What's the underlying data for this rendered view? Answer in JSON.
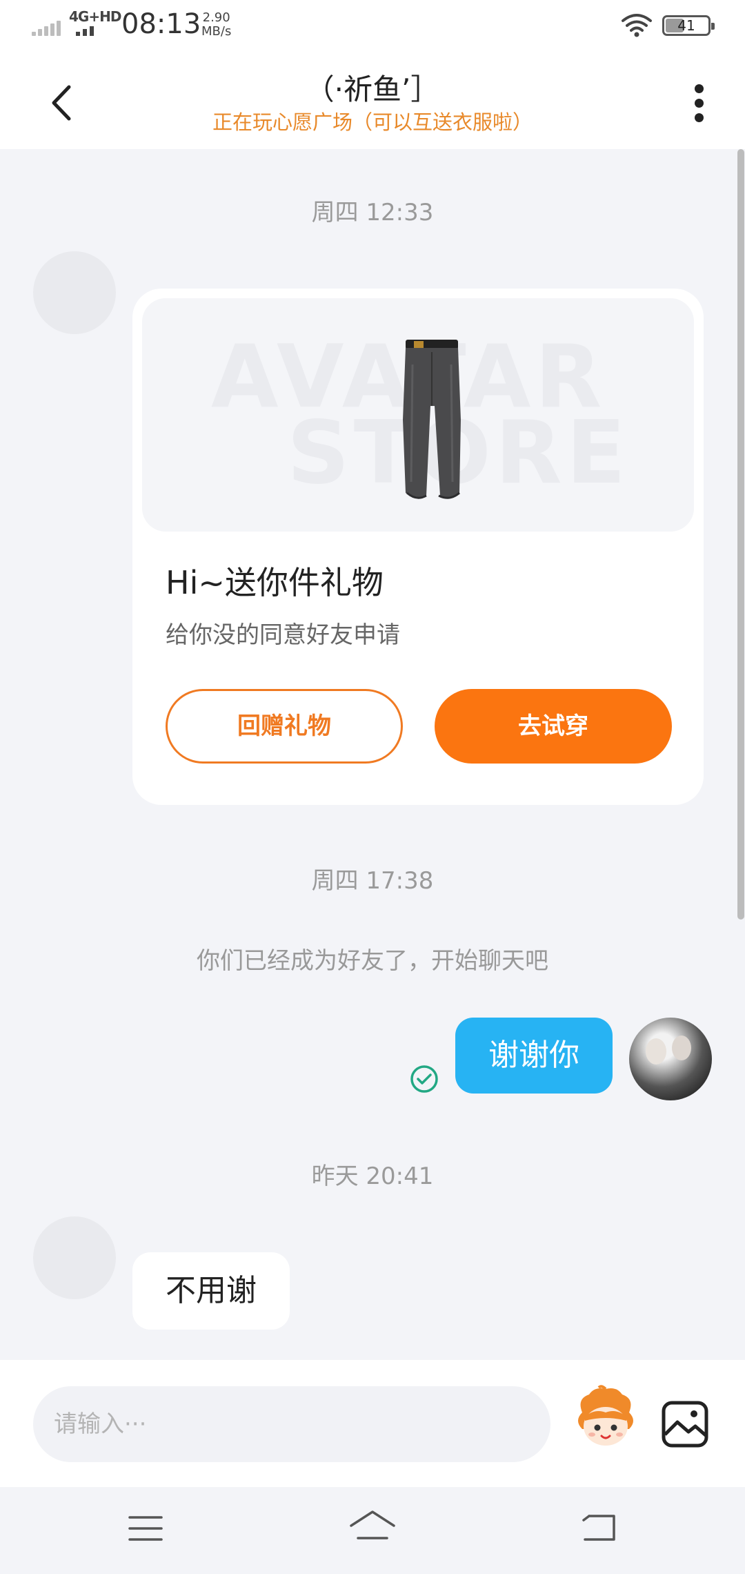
{
  "status_bar": {
    "network": "4G+HD",
    "time": "08:13",
    "speed_value": "2.90",
    "speed_unit": "MB/s",
    "battery": "41",
    "battery_level": 0.41
  },
  "header": {
    "title": "（·祈鱼’］",
    "subtitle": "正在玩心愿广场（可以互送衣服啦）"
  },
  "chat": {
    "timestamp_1": "周四 12:33",
    "gift_card": {
      "watermark_1": "AVATAR",
      "watermark_2": "STORE",
      "title": "Hi~送你件礼物",
      "description": "给你没的同意好友申请",
      "return_gift_label": "回赠礼物",
      "try_on_label": "去试穿"
    },
    "timestamp_2": "周四 17:38",
    "system_message": "你们已经成为好友了，开始聊天吧",
    "sent_message": "谢谢你",
    "timestamp_3": "昨天 20:41",
    "received_message": "不用谢"
  },
  "input_bar": {
    "placeholder": "请输入···"
  },
  "icons": {
    "back": "chevron-left-icon",
    "more": "more-vertical-icon",
    "read": "check-circle-icon",
    "emoji": "mascot-emoji-icon",
    "image": "image-icon",
    "nav_menu": "menu-icon",
    "nav_home": "home-icon",
    "nav_back": "back-icon"
  },
  "colors": {
    "accent_orange": "#fb7510",
    "subtitle_orange": "#e8892a",
    "sent_bubble": "#27b3f3",
    "read_check": "#22a884"
  }
}
